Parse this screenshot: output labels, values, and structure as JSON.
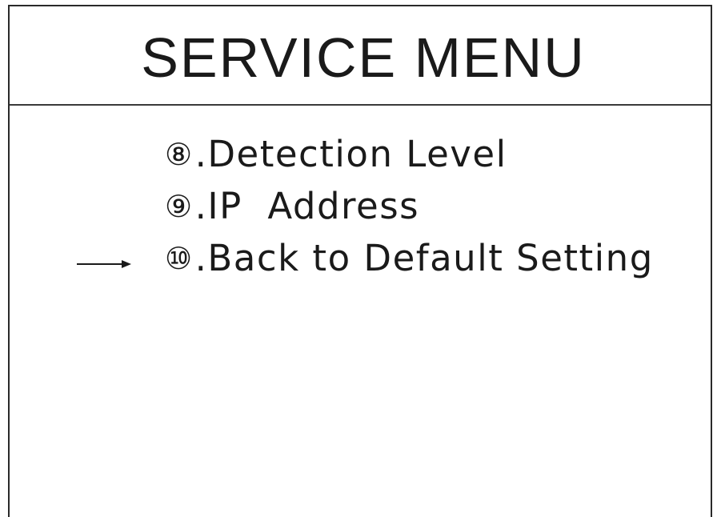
{
  "header": {
    "title": "SERVICE MENU"
  },
  "menu": {
    "items": [
      {
        "number": "⑧",
        "label": ".Detection Level"
      },
      {
        "number": "⑨",
        "label": ".IP  Address"
      },
      {
        "number": "⑩",
        "label": ".Back to Default Setting"
      }
    ],
    "selected_index": 2,
    "selector_icon": "arrow-right-icon"
  }
}
